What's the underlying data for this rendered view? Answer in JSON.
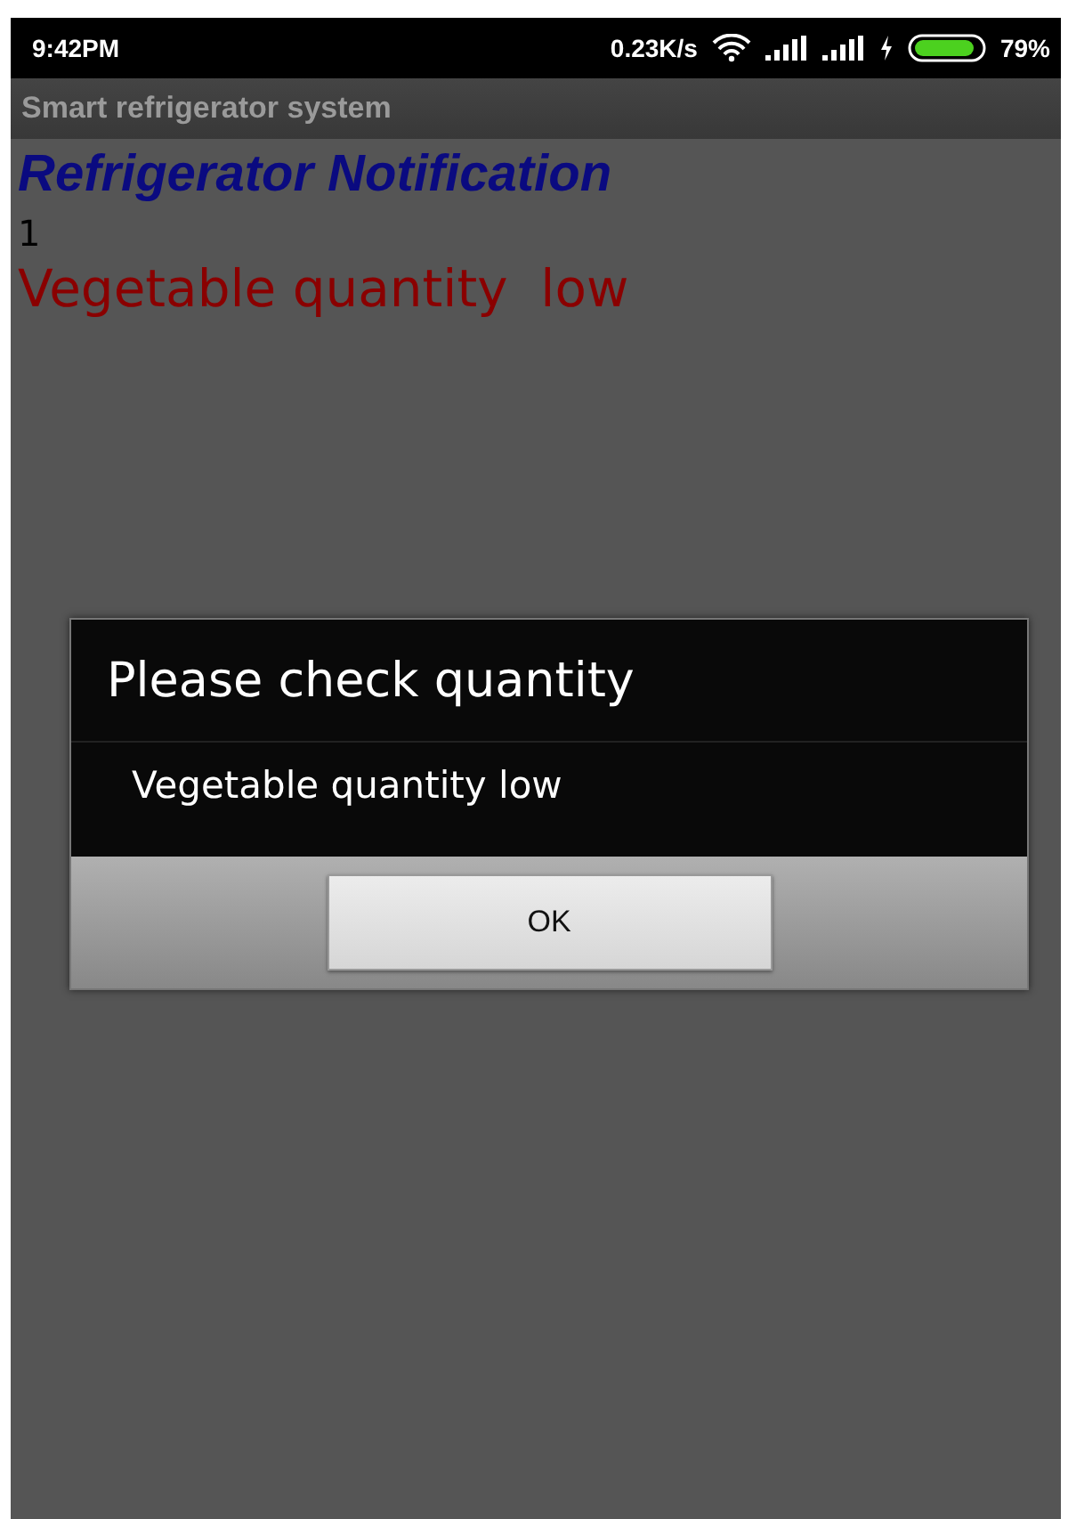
{
  "status_bar": {
    "time": "9:42PM",
    "speed": "0.23K/s",
    "battery": "79%"
  },
  "action_bar": {
    "title": "Smart refrigerator system"
  },
  "content": {
    "heading": "Refrigerator Notification",
    "count": "1",
    "alert": "Vegetable quantity  low"
  },
  "dialog": {
    "title": "Please check quantity",
    "message": "Vegetable quantity low",
    "buttons": [
      "OK"
    ]
  }
}
